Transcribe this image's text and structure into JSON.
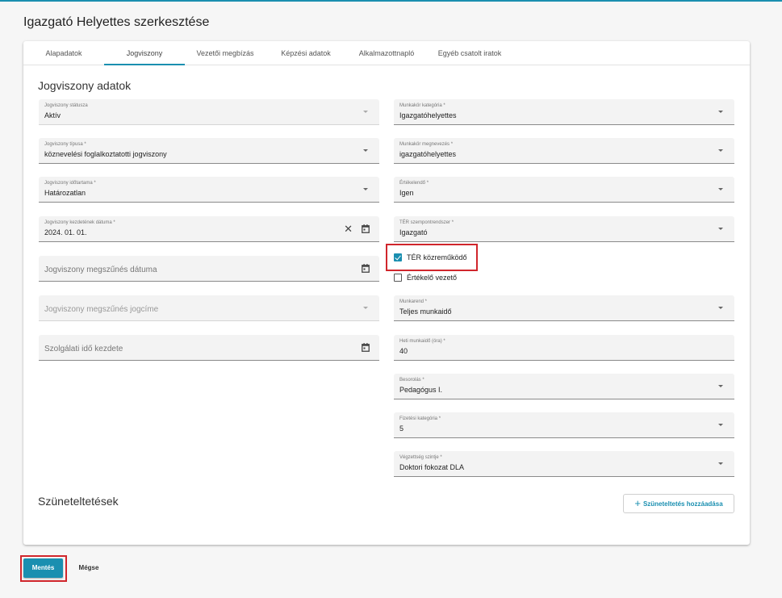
{
  "page_title": "Igazgató Helyettes szerkesztése",
  "tabs": [
    {
      "label": "Alapadatok"
    },
    {
      "label": "Jogviszony"
    },
    {
      "label": "Vezetői megbízás"
    },
    {
      "label": "Képzési adatok"
    },
    {
      "label": "Alkalmazottnapló"
    },
    {
      "label": "Egyéb csatolt iratok"
    }
  ],
  "active_tab": "Jogviszony",
  "section_title": "Jogviszony adatok",
  "left_fields": {
    "status": {
      "label": "Jogviszony státusza",
      "value": "Aktív"
    },
    "type": {
      "label": "Jogviszony típusa *",
      "value": "köznevelési foglalkoztatotti jogviszony"
    },
    "duration": {
      "label": "Jogviszony időtartama *",
      "value": "Határozatlan"
    },
    "start_date": {
      "label": "Jogviszony kezdetének dátuma *",
      "value": "2024. 01. 01."
    },
    "end_date": {
      "placeholder": "Jogviszony megszűnés dátuma"
    },
    "end_reason": {
      "placeholder": "Jogviszony megszűnés jogcíme"
    },
    "service_start": {
      "placeholder": "Szolgálati idő kezdete"
    }
  },
  "right_fields": {
    "job_category": {
      "label": "Munkakör kategória *",
      "value": "Igazgatóhelyettes"
    },
    "job_title": {
      "label": "Munkakör megnevezés *",
      "value": "igazgatóhelyettes"
    },
    "evaluated": {
      "label": "Értékelendő *",
      "value": "Igen"
    },
    "ter_system": {
      "label": "TÉR szempontrendszer *",
      "value": "Igazgató"
    },
    "work_schedule": {
      "label": "Munkarend *",
      "value": "Teljes munkaidő"
    },
    "weekly_hours": {
      "label": "Heti munkaidő (óra) *",
      "value": "40"
    },
    "classification": {
      "label": "Besorolás *",
      "value": "Pedagógus I."
    },
    "pay_category": {
      "label": "Fizetési kategória *",
      "value": "5"
    },
    "education_level": {
      "label": "Végzettség szintje *",
      "value": "Doktori fokozat DLA"
    }
  },
  "checkboxes": {
    "ter_contributor": {
      "label": "TÉR közreműködő",
      "checked": true
    },
    "evaluating_manager": {
      "label": "Értékelő vezető",
      "checked": false
    }
  },
  "suspensions": {
    "title": "Szüneteltetések",
    "add_button": "Szüneteltetés hozzáadása"
  },
  "footer": {
    "save": "Mentés",
    "cancel": "Mégse"
  },
  "colors": {
    "accent": "#1a8fb0",
    "highlight": "#d0262c"
  }
}
